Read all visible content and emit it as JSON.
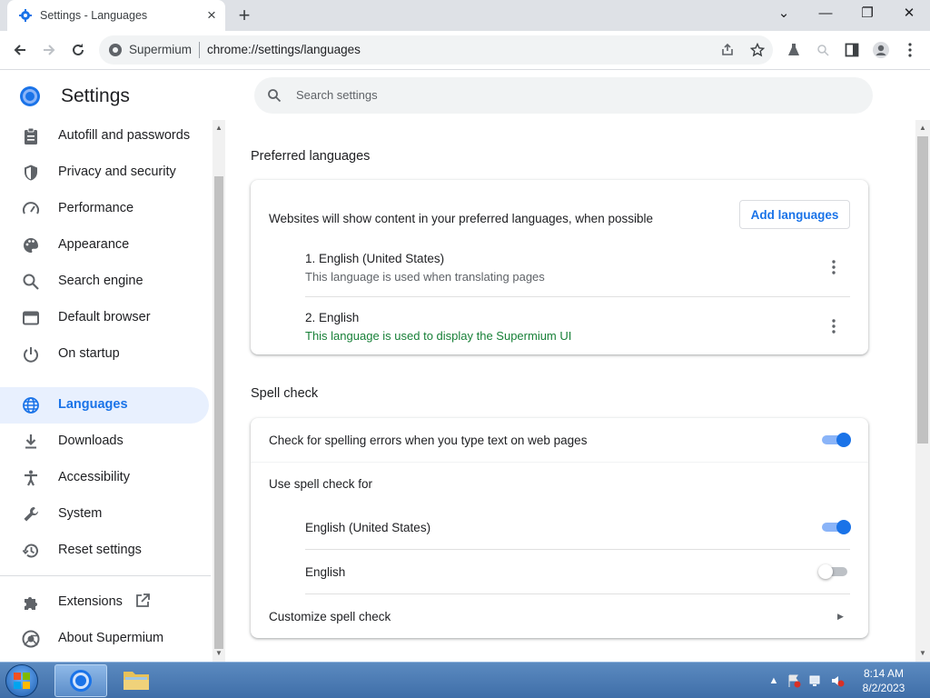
{
  "browser": {
    "tab_title": "Settings - Languages",
    "new_tab_symbol": "+",
    "close_symbol": "×",
    "window_controls": {
      "tab_search": "⌄",
      "minimize": "—",
      "maximize": "❐",
      "close": "✕"
    },
    "omnibox": {
      "origin": "Supermium",
      "url": "chrome://settings/languages"
    }
  },
  "settings": {
    "title": "Settings",
    "search_placeholder": "Search settings",
    "nav": [
      {
        "label": "Autofill and passwords",
        "icon": "clipboard-icon"
      },
      {
        "label": "Privacy and security",
        "icon": "shield-icon"
      },
      {
        "label": "Performance",
        "icon": "speedometer-icon"
      },
      {
        "label": "Appearance",
        "icon": "palette-icon"
      },
      {
        "label": "Search engine",
        "icon": "search-icon"
      },
      {
        "label": "Default browser",
        "icon": "browser-window-icon"
      },
      {
        "label": "On startup",
        "icon": "power-icon"
      },
      {
        "label": "Languages",
        "icon": "globe-icon",
        "active": true
      },
      {
        "label": "Downloads",
        "icon": "download-icon"
      },
      {
        "label": "Accessibility",
        "icon": "accessibility-icon"
      },
      {
        "label": "System",
        "icon": "wrench-icon"
      },
      {
        "label": "Reset settings",
        "icon": "history-icon"
      },
      {
        "label": "Extensions",
        "icon": "puzzle-icon"
      },
      {
        "label": "About Supermium",
        "icon": "supermium-logo-icon"
      }
    ]
  },
  "preferred": {
    "section_title": "Preferred languages",
    "description": "Websites will show content in your preferred languages, when possible",
    "add_button": "Add languages",
    "languages": [
      {
        "name": "1. English (United States)",
        "note": "This language is used when translating pages"
      },
      {
        "name": "2. English",
        "note": "This language is used to display the Supermium UI"
      }
    ]
  },
  "spell": {
    "section_title": "Spell check",
    "check_label": "Check for spelling errors when you type text on web pages",
    "check_on": true,
    "use_for_label": "Use spell check for",
    "languages": [
      {
        "name": "English (United States)",
        "on": true
      },
      {
        "name": "English",
        "on": false
      }
    ],
    "customize_label": "Customize spell check"
  },
  "taskbar": {
    "time": "8:14 AM",
    "date": "8/2/2023"
  },
  "colors": {
    "accent": "#1a73e8",
    "active_nav_bg": "#e8f0fe",
    "green_note": "#188038"
  }
}
